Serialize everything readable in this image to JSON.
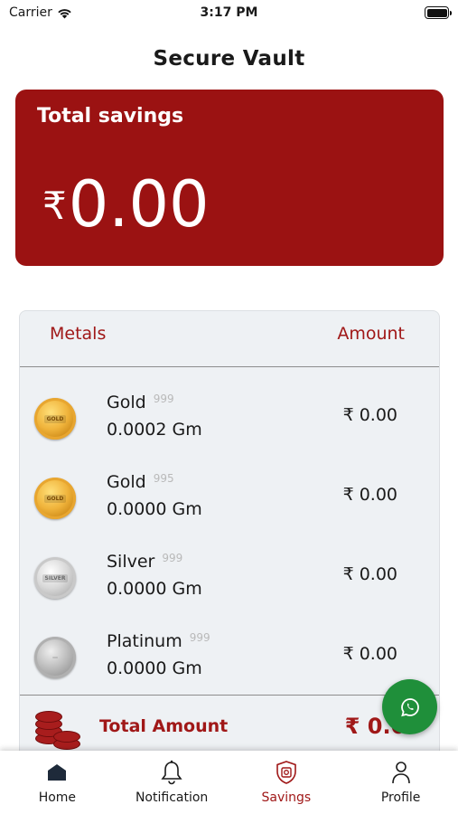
{
  "status_bar": {
    "carrier": "Carrier",
    "time": "3:17 PM"
  },
  "page_title": "Secure Vault",
  "savings": {
    "label": "Total savings",
    "currency": "₹",
    "amount": "0.00"
  },
  "table": {
    "headers": {
      "metals": "Metals",
      "amount": "Amount"
    },
    "rows": [
      {
        "name": "Gold",
        "purity": "999",
        "quantity": "0.0002 Gm",
        "amount": "₹ 0.00",
        "coin": "gold",
        "coin_label": "GOLD"
      },
      {
        "name": "Gold",
        "purity": "995",
        "quantity": "0.0000 Gm",
        "amount": "₹ 0.00",
        "coin": "gold",
        "coin_label": "GOLD"
      },
      {
        "name": "Silver",
        "purity": "999",
        "quantity": "0.0000 Gm",
        "amount": "₹ 0.00",
        "coin": "silver",
        "coin_label": "SILVER"
      },
      {
        "name": "Platinum",
        "purity": "999",
        "quantity": "0.0000 Gm",
        "amount": "₹ 0.00",
        "coin": "platinum",
        "coin_label": ""
      }
    ],
    "total": {
      "label": "Total Amount",
      "amount": "₹ 0.00"
    }
  },
  "nav": [
    {
      "label": "Home",
      "icon": "home-icon",
      "active": false
    },
    {
      "label": "Notification",
      "icon": "bell-icon",
      "active": false
    },
    {
      "label": "Savings",
      "icon": "vault-shield-icon",
      "active": true
    },
    {
      "label": "Profile",
      "icon": "person-icon",
      "active": false
    }
  ],
  "colors": {
    "brand_red": "#9b1212",
    "accent_red": "#a01818",
    "whatsapp_green": "#1f8f3a"
  }
}
